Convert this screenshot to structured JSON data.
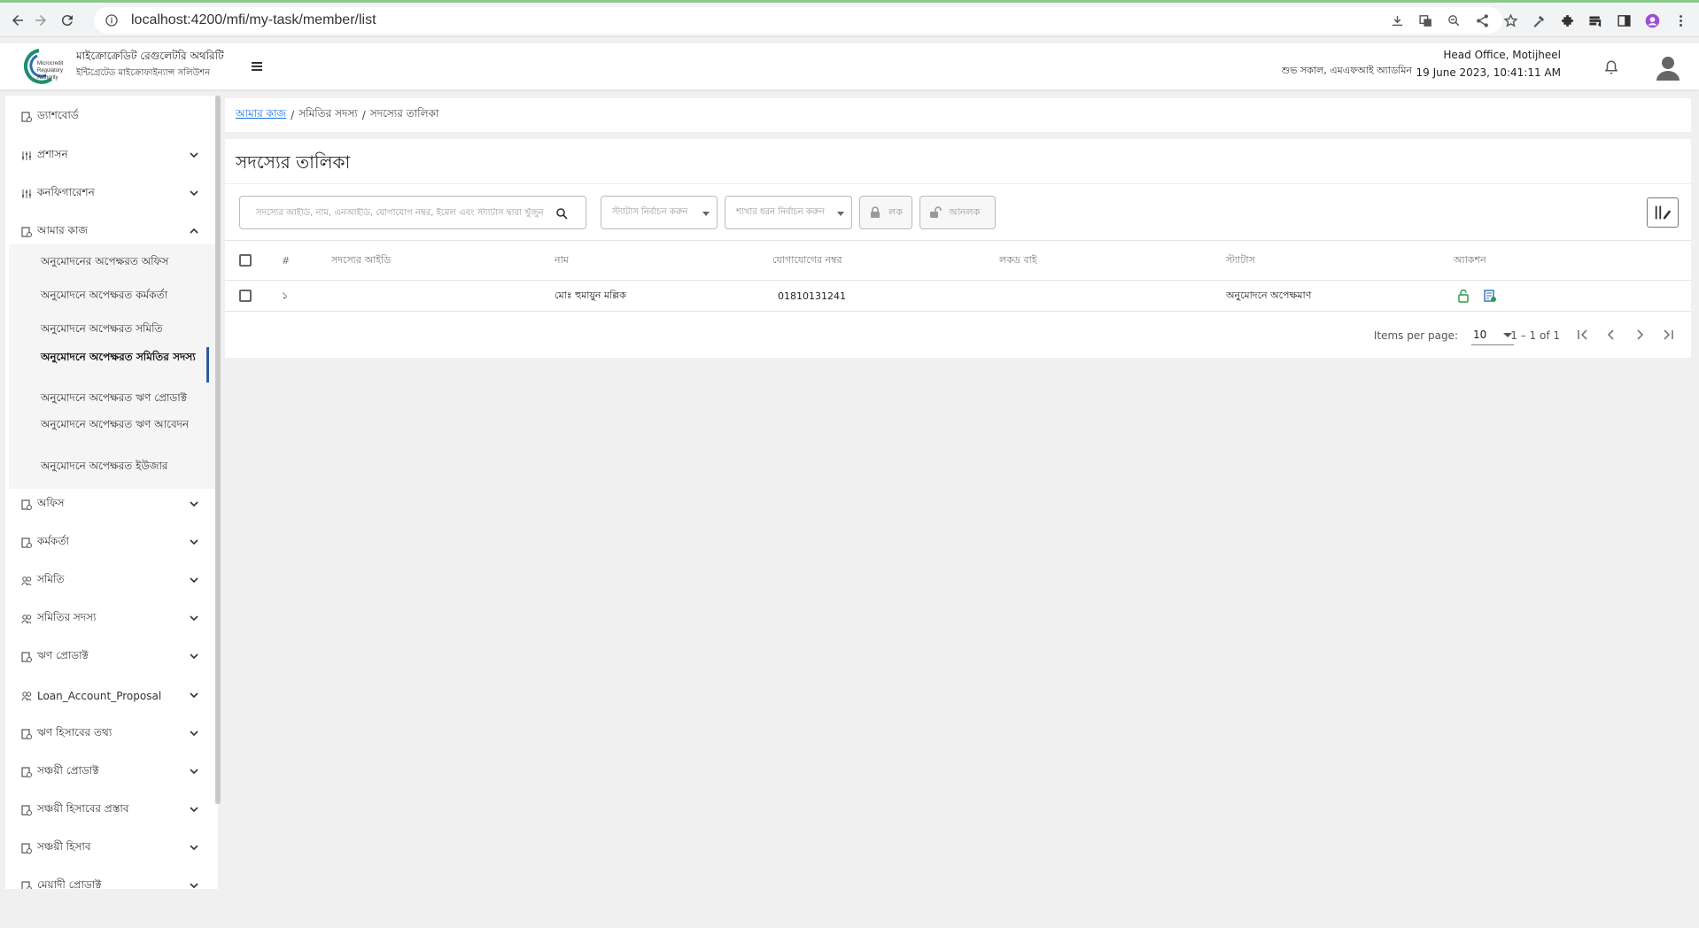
{
  "browser": {
    "url": "localhost:4200/mfi/my-task/member/list"
  },
  "header": {
    "brand_title": "মাইক্রোক্রেডিট রেগুলেটরি অথরিটি",
    "brand_subtitle": "ইন্টিগ্রেটেড মাইক্রোফাইন্যান্স সলিউশন",
    "logo_text": "Microcredit Regulatory Authority",
    "greeting": "শুভ সকাল, এমএফআই অ্যাডমিন",
    "office": "Head Office, Motijheel",
    "datetime": "19 June 2023, 10:41:11 AM"
  },
  "sidebar": {
    "dashboard": "ড্যাশবোর্ড",
    "items": [
      {
        "label": "প্রশাসন",
        "icon": "sliders-icon"
      },
      {
        "label": "কনফিগারেশন",
        "icon": "sliders-icon"
      },
      {
        "label": "আমার কাজ",
        "icon": "task-icon"
      },
      {
        "label": "অফিস",
        "icon": "office-icon"
      },
      {
        "label": "কর্মকর্তা",
        "icon": "officer-icon"
      },
      {
        "label": "সমিতি",
        "icon": "group-icon"
      },
      {
        "label": "সমিতির সদস্য",
        "icon": "members-icon"
      },
      {
        "label": "ঋণ প্রোডাক্ট",
        "icon": "product-icon"
      },
      {
        "label": "Loan_Account_Proposal",
        "icon": "proposal-icon"
      },
      {
        "label": "ঋণ হিসাবের তথ্য",
        "icon": "account-icon"
      },
      {
        "label": "সঞ্চয়ী প্রোডাক্ট",
        "icon": "savings-icon"
      },
      {
        "label": "সঞ্চয়ী হিসাবের প্রস্তাব",
        "icon": "savings-proposal-icon"
      },
      {
        "label": "সঞ্চয়ী হিসাব",
        "icon": "savings-account-icon"
      },
      {
        "label": "মেয়াদী প্রোডাক্ট",
        "icon": "term-product-icon"
      }
    ],
    "sub_items": [
      "অনুমোদনের অপেক্ষরত অফিস",
      "অনুমোদনে অপেক্ষরত কর্মকর্তা",
      "অনুমোদনে অপেক্ষরত সমিতি",
      "অনুমোদনে অপেক্ষরত সমিতির সদস্য",
      "অনুমোদনে অপেক্ষরত ঋণ প্রোডাক্ট",
      "অনুমোদনে অপেক্ষরত ঋণ আবেদন",
      "অনুমোদনে অপেক্ষরত ইউজার"
    ]
  },
  "breadcrumb": {
    "root": "আমার কাজ",
    "middle": "সমিতির সদস্য",
    "current": "সদস্যের তালিকা"
  },
  "page": {
    "title": "সদস্যের তালিকা"
  },
  "filters": {
    "search_placeholder": "সদস্যের আইডি, নাম, এনআইডি, যোগাযোগ নম্বর, ইমেল এবং স্ট্যাটাস দ্বারা খুঁজুন",
    "status_placeholder": "স্ট্যাটাস নির্বাচন করুন",
    "branch_placeholder": "শাখার ধরন নির্বাচন করুন",
    "lock_label": "লক",
    "unlock_label": "আনলক"
  },
  "table": {
    "columns": [
      "#",
      "সদস্যের আইডি",
      "নাম",
      "যোগাযোগের নম্বর",
      "লকড বাই",
      "স্ট্যাটাস",
      "অ্যাকশন"
    ],
    "rows": [
      {
        "index": "১",
        "member_id": "",
        "name": "মোঃ হুমায়ুন মল্লিক",
        "phone": "01810131241",
        "locked_by": "",
        "status": "অনুমোদনে অপেক্ষমাণ"
      }
    ]
  },
  "paginator": {
    "items_per_page_label": "Items per page:",
    "page_size": "10",
    "range": "1 – 1 of 1"
  },
  "colors": {
    "accent": "#1a73e8",
    "active_bar": "#2b5c9e",
    "unlock_green": "#2e9d4f"
  }
}
